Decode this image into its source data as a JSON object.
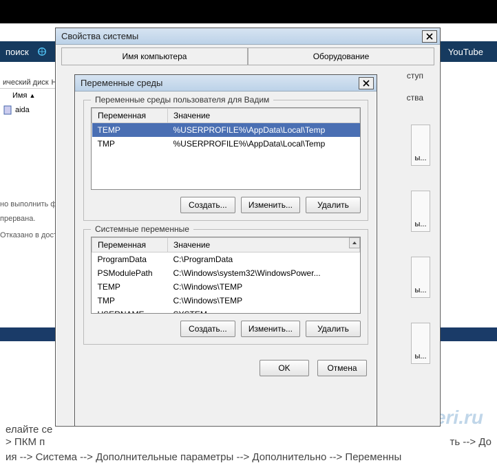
{
  "background": {
    "nav_search": "поиск",
    "nav_youtube": "YouTube",
    "left_label1": "ический диск",
    "left_label2": "Н",
    "left_col_name": "Имя",
    "left_file": "aida",
    "msg1": "но выполнить фай",
    "msg2": "прервана.",
    "msg3": "Отказано в доступ",
    "footer_line1": "> ПКМ п",
    "footer_line2": "елайте се",
    "footer_line3": "ия --> Система --> Дополнительные параметры --> Дополнительно --> Переменны",
    "footer_right1": "ть --> До",
    "watermark": "tehneri.ru"
  },
  "parentWindow": {
    "title": "Свойства системы",
    "tabs": [
      "Имя компьютера",
      "Оборудование"
    ],
    "tab2_row": [
      "ступ"
    ],
    "side_label": "ства"
  },
  "envWindow": {
    "title": "Переменные среды",
    "userVars": {
      "legend": "Переменные среды пользователя для Вадим",
      "col1": "Переменная",
      "col2": "Значение",
      "rows": [
        {
          "name": "TEMP",
          "value": "%USERPROFILE%\\AppData\\Local\\Temp",
          "selected": true
        },
        {
          "name": "TMP",
          "value": "%USERPROFILE%\\AppData\\Local\\Temp",
          "selected": false
        }
      ]
    },
    "sysVars": {
      "legend": "Системные переменные",
      "col1": "Переменная",
      "col2": "Значение",
      "rows": [
        {
          "name": "ProgramData",
          "value": "C:\\ProgramData"
        },
        {
          "name": "PSModulePath",
          "value": "C:\\Windows\\system32\\WindowsPower..."
        },
        {
          "name": "TEMP",
          "value": " C:\\Windows\\TEMP"
        },
        {
          "name": "TMP",
          "value": "C:\\Windows\\TEMP"
        },
        {
          "name": "USERNAME",
          "value": "SYSTEM"
        }
      ]
    },
    "buttons": {
      "create": "Создать...",
      "edit": "Изменить...",
      "delete": "Удалить",
      "ok": "OK",
      "cancel": "Отмена"
    }
  }
}
